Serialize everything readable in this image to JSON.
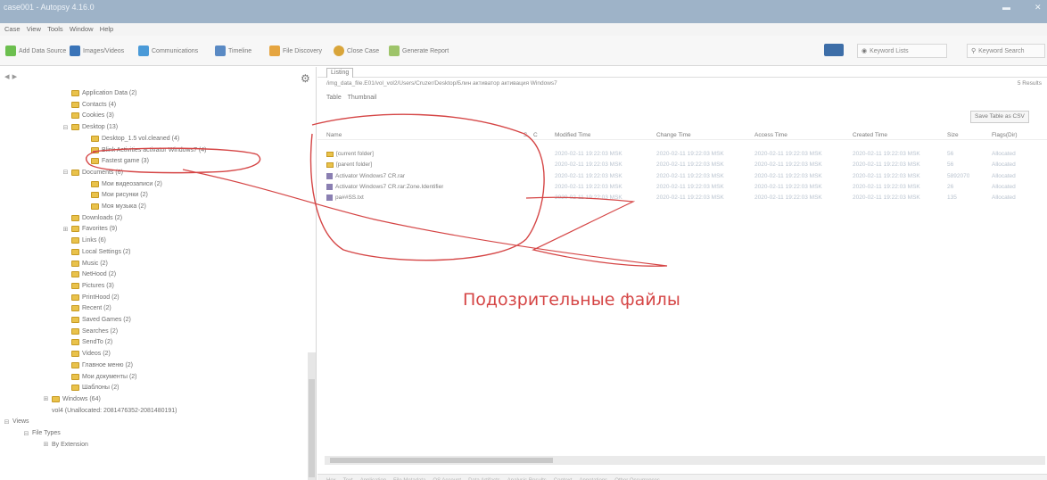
{
  "app": {
    "title": "case001 - Autopsy 4.16.0",
    "close": "✕",
    "minimize": "▬"
  },
  "menu": [
    "Case",
    "View",
    "Tools",
    "Window",
    "Help"
  ],
  "toolbar": {
    "add_data_source": "Add Data Source",
    "images_videos": "Images/Videos",
    "communications": "Communications",
    "timeline": "Timeline",
    "file_discovery": "File Discovery",
    "close_case": "Close Case",
    "generate_report": "Generate Report",
    "keyword_lists": "Keyword Lists",
    "keyword_search": "Keyword Search"
  },
  "left_panel": {
    "tree": [
      {
        "label": "Application Data (2)",
        "depth": 3,
        "folder": true
      },
      {
        "label": "Contacts (4)",
        "depth": 3,
        "folder": true
      },
      {
        "label": "Cookies (3)",
        "depth": 3,
        "folder": true
      },
      {
        "label": "Desktop (13)",
        "depth": 3,
        "folder": true,
        "expander": "⊟"
      },
      {
        "label": "Desktop_1.5 vol.cleaned (4)",
        "depth": 4,
        "folder": true
      },
      {
        "label": "Blink Activities activator Windows7 (4)",
        "depth": 4,
        "folder": true
      },
      {
        "label": "Fastest game (3)",
        "depth": 4,
        "folder": true
      },
      {
        "label": "Documents (6)",
        "depth": 3,
        "folder": true,
        "expander": "⊟"
      },
      {
        "label": "Мои видеозаписи (2)",
        "depth": 4,
        "folder": true
      },
      {
        "label": "Мои рисунки (2)",
        "depth": 4,
        "folder": true
      },
      {
        "label": "Моя музыка (2)",
        "depth": 4,
        "folder": true
      },
      {
        "label": "Downloads (2)",
        "depth": 3,
        "folder": true
      },
      {
        "label": "Favorites (9)",
        "depth": 3,
        "folder": true,
        "expander": "⊞"
      },
      {
        "label": "Links (6)",
        "depth": 3,
        "folder": true
      },
      {
        "label": "Local Settings (2)",
        "depth": 3,
        "folder": true
      },
      {
        "label": "Music (2)",
        "depth": 3,
        "folder": true
      },
      {
        "label": "NetHood (2)",
        "depth": 3,
        "folder": true
      },
      {
        "label": "Pictures (3)",
        "depth": 3,
        "folder": true
      },
      {
        "label": "PrintHood (2)",
        "depth": 3,
        "folder": true
      },
      {
        "label": "Recent (2)",
        "depth": 3,
        "folder": true
      },
      {
        "label": "Saved Games (2)",
        "depth": 3,
        "folder": true
      },
      {
        "label": "Searches (2)",
        "depth": 3,
        "folder": true
      },
      {
        "label": "SendTo (2)",
        "depth": 3,
        "folder": true
      },
      {
        "label": "Videos (2)",
        "depth": 3,
        "folder": true
      },
      {
        "label": "Главное меню (2)",
        "depth": 3,
        "folder": true
      },
      {
        "label": "Мои документы (2)",
        "depth": 3,
        "folder": true
      },
      {
        "label": "Шаблоны (2)",
        "depth": 3,
        "folder": true
      },
      {
        "label": "Windows (64)",
        "depth": 2,
        "folder": true,
        "expander": "⊞"
      },
      {
        "label": "vol4 (Unallocated: 2081476352-2081480191)",
        "depth": 2,
        "folder": false
      },
      {
        "label": "Views",
        "depth": 0,
        "folder": false,
        "expander": "⊟"
      },
      {
        "label": "File Types",
        "depth": 1,
        "folder": false,
        "expander": "⊟"
      },
      {
        "label": "By Extension",
        "depth": 2,
        "folder": false,
        "expander": "⊞"
      }
    ]
  },
  "right_panel": {
    "tab_label": "Listing",
    "path": "/img_data_file.E01/vol_vol2/Users/Cruzer/Desktop/Блин активатор активация Windows7",
    "results_count": "5 Results",
    "subtabs": [
      "Table",
      "Thumbnail"
    ],
    "save_table": "Save Table as CSV",
    "columns": [
      "Name",
      "S",
      "C",
      "Modified Time",
      "Change Time",
      "Access Time",
      "Created Time",
      "Size",
      "Flags(Dir)"
    ],
    "rows": [
      {
        "icon": "folder",
        "name": "[current folder]",
        "s": "",
        "c": "",
        "modified": "2020-02-11 19:22:03 MSK",
        "change": "2020-02-11 19:22:03 MSK",
        "access": "2020-02-11 19:22:03 MSK",
        "created": "2020-02-11 19:22:03 MSK",
        "size": "56",
        "flags": "Allocated"
      },
      {
        "icon": "folder",
        "name": "[parent folder]",
        "s": "",
        "c": "",
        "modified": "2020-02-11 19:22:03 MSK",
        "change": "2020-02-11 19:22:03 MSK",
        "access": "2020-02-11 19:22:03 MSK",
        "created": "2020-02-11 19:22:03 MSK",
        "size": "56",
        "flags": "Allocated"
      },
      {
        "icon": "file",
        "name": "Activator Windows7 CR.rar",
        "s": "",
        "c": "",
        "modified": "2020-02-11 19:22:03 MSK",
        "change": "2020-02-11 19:22:03 MSK",
        "access": "2020-02-11 19:22:03 MSK",
        "created": "2020-02-11 19:22:03 MSK",
        "size": "5892070",
        "flags": "Allocated"
      },
      {
        "icon": "file",
        "name": "Activator Windows7 CR.rar:Zone.Identifier",
        "s": "",
        "c": "",
        "modified": "2020-02-11 19:22:03 MSK",
        "change": "2020-02-11 19:22:03 MSK",
        "access": "2020-02-11 19:22:03 MSK",
        "created": "2020-02-11 19:22:03 MSK",
        "size": "26",
        "flags": "Allocated"
      },
      {
        "icon": "file",
        "name": "pa##SS.txt",
        "s": "",
        "c": "",
        "modified": "2020-02-11 19:22:03 MSK",
        "change": "2020-02-11 19:22:03 MSK",
        "access": "2020-02-11 19:22:03 MSK",
        "created": "2020-02-11 19:22:03 MSK",
        "size": "135",
        "flags": "Allocated"
      }
    ],
    "bottom_tabs": [
      "Hex",
      "Text",
      "Application",
      "File Metadata",
      "OS Account",
      "Data Artifacts",
      "Analysis Results",
      "Context",
      "Annotations",
      "Other Occurrences"
    ]
  },
  "annotation": {
    "text": "Подозрительные файлы",
    "color": "#d54545"
  }
}
